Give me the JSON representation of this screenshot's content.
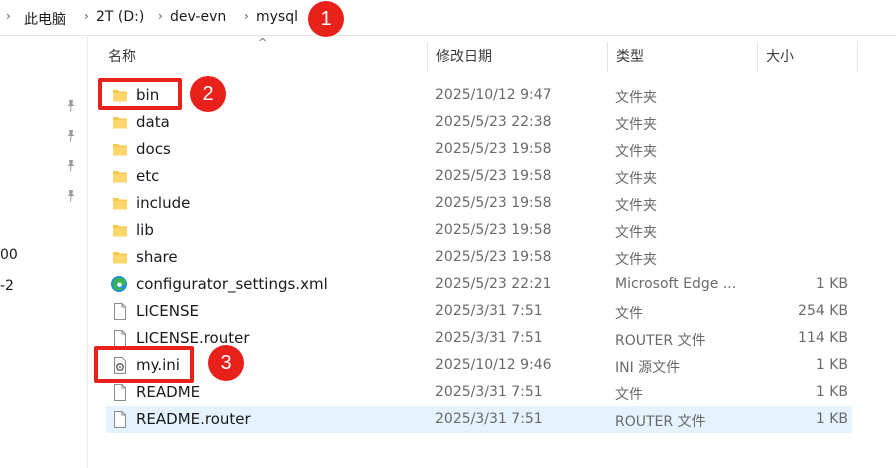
{
  "breadcrumb": {
    "items": [
      "此电脑",
      "2T (D:)",
      "dev-evn",
      "mysql"
    ]
  },
  "nav": {
    "texts": [
      "00",
      "-2"
    ]
  },
  "columns": {
    "name": "名称",
    "modified": "修改日期",
    "type": "类型",
    "size": "大小"
  },
  "files": [
    {
      "name": "bin",
      "modified": "2025/10/12 9:47",
      "type": "文件夹",
      "size": "",
      "icon": "folder-icon"
    },
    {
      "name": "data",
      "modified": "2025/5/23 22:38",
      "type": "文件夹",
      "size": "",
      "icon": "folder-icon"
    },
    {
      "name": "docs",
      "modified": "2025/5/23 19:58",
      "type": "文件夹",
      "size": "",
      "icon": "folder-icon"
    },
    {
      "name": "etc",
      "modified": "2025/5/23 19:58",
      "type": "文件夹",
      "size": "",
      "icon": "folder-icon"
    },
    {
      "name": "include",
      "modified": "2025/5/23 19:58",
      "type": "文件夹",
      "size": "",
      "icon": "folder-icon"
    },
    {
      "name": "lib",
      "modified": "2025/5/23 19:58",
      "type": "文件夹",
      "size": "",
      "icon": "folder-icon"
    },
    {
      "name": "share",
      "modified": "2025/5/23 19:58",
      "type": "文件夹",
      "size": "",
      "icon": "folder-icon"
    },
    {
      "name": "configurator_settings.xml",
      "modified": "2025/5/23 22:21",
      "type": "Microsoft Edge ...",
      "size": "1 KB",
      "icon": "edge-icon"
    },
    {
      "name": "LICENSE",
      "modified": "2025/3/31 7:51",
      "type": "文件",
      "size": "254 KB",
      "icon": "file-icon"
    },
    {
      "name": "LICENSE.router",
      "modified": "2025/3/31 7:51",
      "type": "ROUTER 文件",
      "size": "114 KB",
      "icon": "file-icon"
    },
    {
      "name": "my.ini",
      "modified": "2025/10/12 9:46",
      "type": "INI 源文件",
      "size": "1 KB",
      "icon": "settings-file-icon"
    },
    {
      "name": "README",
      "modified": "2025/3/31 7:51",
      "type": "文件",
      "size": "1 KB",
      "icon": "file-icon"
    },
    {
      "name": "README.router",
      "modified": "2025/3/31 7:51",
      "type": "ROUTER 文件",
      "size": "1 KB",
      "icon": "file-icon"
    }
  ],
  "annotations": {
    "badge_1": "1",
    "badge_2": "2",
    "badge_3": "3"
  },
  "colors": {
    "annotation_red": "#e8221b",
    "folder_yellow": "#f5c84c",
    "selection_blue": "#e5f3ff",
    "edge_blue": "#1b8fe0",
    "edge_green": "#39b54a"
  }
}
